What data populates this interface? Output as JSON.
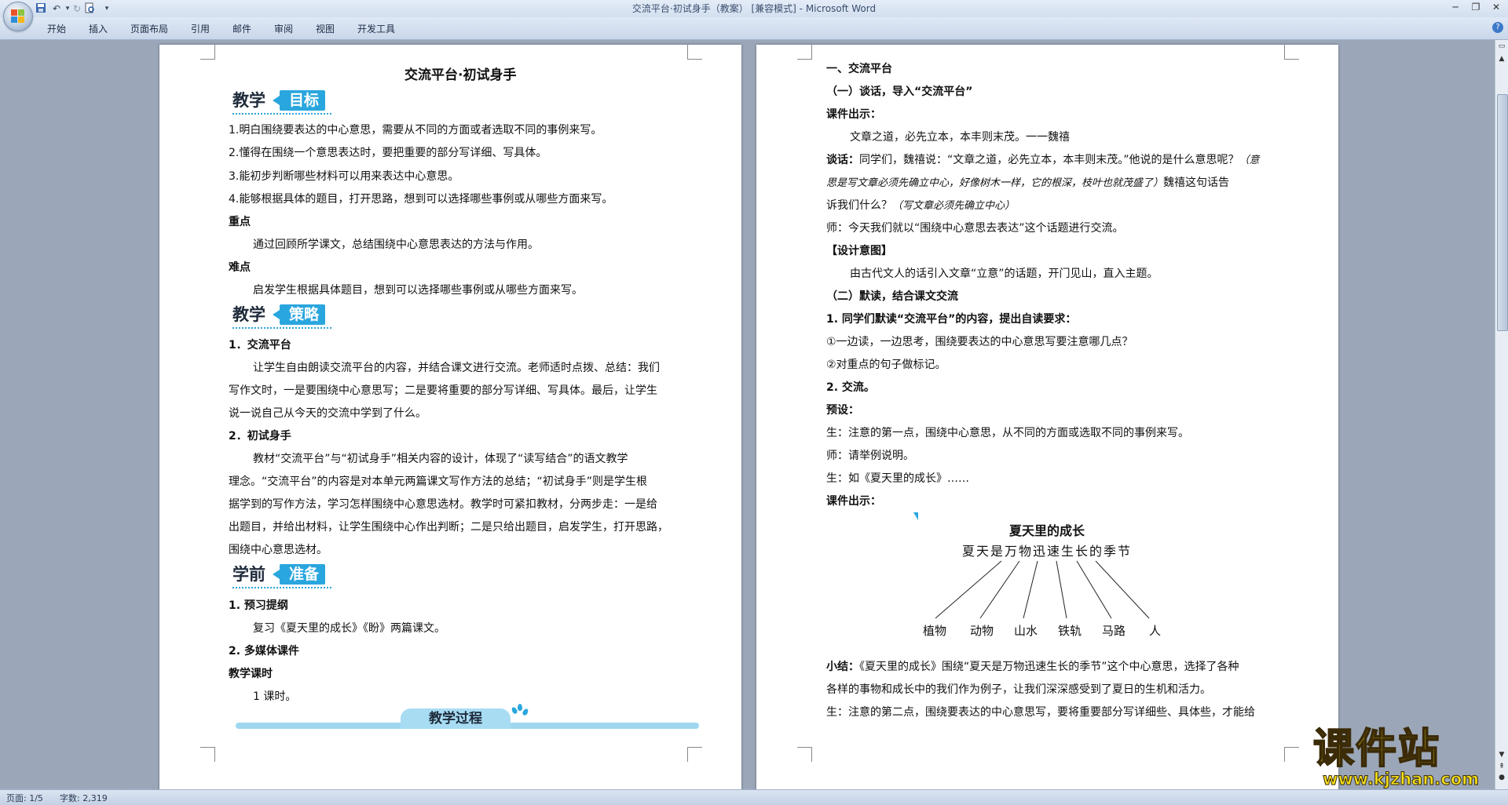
{
  "window": {
    "title": "交流平台·初试身手（教案） [兼容模式] - Microsoft Word"
  },
  "quick_access": {
    "save_icon": "save-icon",
    "undo_icon": "undo-icon",
    "redo_icon": "redo-icon",
    "print_preview_icon": "print-preview-icon",
    "customize_icon": "dropdown-icon"
  },
  "ribbon": {
    "tabs": [
      "开始",
      "插入",
      "页面布局",
      "引用",
      "邮件",
      "审阅",
      "视图",
      "开发工具"
    ]
  },
  "left_page": {
    "title": "交流平台·初试身手",
    "goal_header": {
      "dark": "教学",
      "pill": "目标"
    },
    "goals": [
      "1.明白围绕要表达的中心意思，需要从不同的方面或者选取不同的事例来写。",
      "2.懂得在围绕一个意思表达时，要把重要的部分写详细、写具体。",
      "3.能初步判断哪些材料可以用来表达中心意思。",
      "4.能够根据具体的题目，打开思路，想到可以选择哪些事例或从哪些方面来写。"
    ],
    "key_label": "重点",
    "key_text": "通过回顾所学课文，总结围绕中心意思表达的方法与作用。",
    "difficulty_label": "难点",
    "difficulty_text": "启发学生根据具体题目，想到可以选择哪些事例或从哪些方面来写。",
    "strategy_header": {
      "dark": "教学",
      "pill": "策略"
    },
    "strategy_1_title": "1．交流平台",
    "strategy_1_lines": [
      "让学生自由朗读交流平台的内容，并结合课文进行交流。老师适时点拨、总结：我们",
      "写作文时，一是要围绕中心意思写；二是要将重要的部分写详细、写具体。最后，让学生",
      "说一说自己从今天的交流中学到了什么。"
    ],
    "strategy_2_title": "2．初试身手",
    "strategy_2_lines": [
      "教材“交流平台”与“初试身手”相关内容的设计，体现了“读写结合”的语文教学",
      "理念。“交流平台”的内容是对本单元两篇课文写作方法的总结；“初试身手”则是学生根",
      "据学到的写作方法，学习怎样围绕中心意思选材。教学时可紧扣教材，分两步走：一是给",
      "出题目，并给出材料，让学生围绕中心作出判断；二是只给出题目，启发学生，打开思路，",
      "围绕中心意思选材。"
    ],
    "prep_header": {
      "dark": "学前",
      "pill": "准备"
    },
    "prep_1_title": "1. 预习提纲",
    "prep_1_text": "复习《夏天里的成长》《盼》两篇课文。",
    "prep_2_title": "2. 多媒体课件",
    "hours_label": "教学课时",
    "hours_text": "1 课时。",
    "process_banner": "教学过程"
  },
  "right_page": {
    "section_1": "一、交流平台",
    "sub_1": "（一）谈话，导入“交流平台”",
    "courseware_label": "课件出示：",
    "quote": "文章之道，必先立本，本丰则末茂。一一魏禧",
    "talk_label": "谈话：",
    "talk_line1_a": "同学们，魏禧说：“文章之道，必先立本，本丰则末茂。”他说的是什么意思呢？",
    "talk_line1_b": "（意",
    "talk_line2_a": "思是写文章必须先确立中心，好像树木一样，它的根深，枝叶也就茂盛了）",
    "talk_line2_b": "魏禧这句话告",
    "talk_line3_a": "诉我们什么？",
    "talk_line3_b": "（写文章必须先确立中心）",
    "teacher_line": "师：今天我们就以“围绕中心意思去表达”这个话题进行交流。",
    "design_label": "【设计意图】",
    "design_text": "由古代文人的话引入文章“立意”的话题，开门见山，直入主题。",
    "sub_2": "（二）默读，结合课文交流",
    "req_title": "1. 同学们默读“交流平台”的内容，提出自读要求：",
    "req_1": "①一边读，一边思考，围绕要表达的中心意思写要注意哪几点？",
    "req_2": "②对重点的句子做标记。",
    "exchange_title": "2. 交流。",
    "preset_label": "预设：",
    "stu_1": "生：注意的第一点，围绕中心意思，从不同的方面或选取不同的事例来写。",
    "teacher_2": "师：请举例说明。",
    "stu_2": "生：如《夏天里的成长》……",
    "courseware_label_2": "课件出示：",
    "diagram": {
      "title": "夏天里的成长",
      "subtitle": "夏天是万物迅速生长的季节",
      "leaves": [
        "植物",
        "动物",
        "山水",
        "铁轨",
        "马路",
        "人"
      ]
    },
    "summary_label": "小结：",
    "summary_line1": "《夏天里的成长》围绕“夏天是万物迅速生长的季节”这个中心意思，选择了各种",
    "summary_line2": "各样的事物和成长中的我们作为例子，让我们深深感受到了夏日的生机和活力。",
    "stu_3": "生：注意的第二点，围绕要表达的中心意思写，要将重要部分写详细些、具体些，才能给"
  },
  "watermark": {
    "main": "课件站",
    "url": "www.kjzhan.com"
  },
  "status_bar": {
    "page": "页面: 1/5",
    "words": "字数: 2,319"
  }
}
